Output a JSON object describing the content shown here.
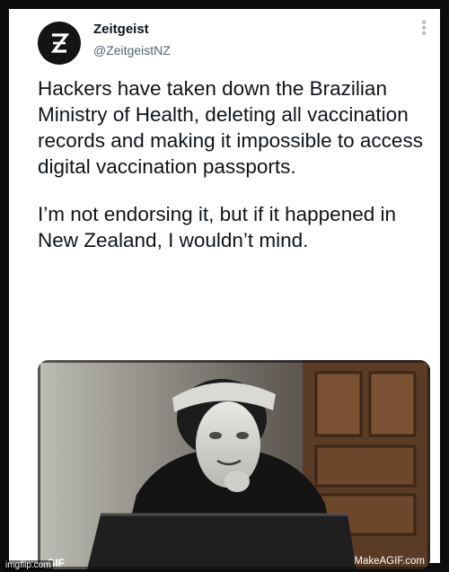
{
  "author": {
    "name": "Zeitgeist",
    "handle": "@ZeitgeistNZ",
    "avatar_glyph": "Ƶ",
    "avatar_icon": "zeitgeist-logo-icon"
  },
  "menu_icon": "more-vertical-icon",
  "tweet": {
    "paragraphs": [
      "Hackers have taken down the Brazilian Ministry of Health, deleting all vaccination records and making it impossible to access digital vaccination passports.",
      "I’m not endorsing it, but if it happened in New Zealand, I wouldn’t mind."
    ]
  },
  "media": {
    "badge": "GIF",
    "watermark": "MakeAGIF.com"
  },
  "site_watermark": "imgflip.com",
  "colors": {
    "frame": "#0d0d0d",
    "text": "#0f1419",
    "secondary": "#536471"
  }
}
